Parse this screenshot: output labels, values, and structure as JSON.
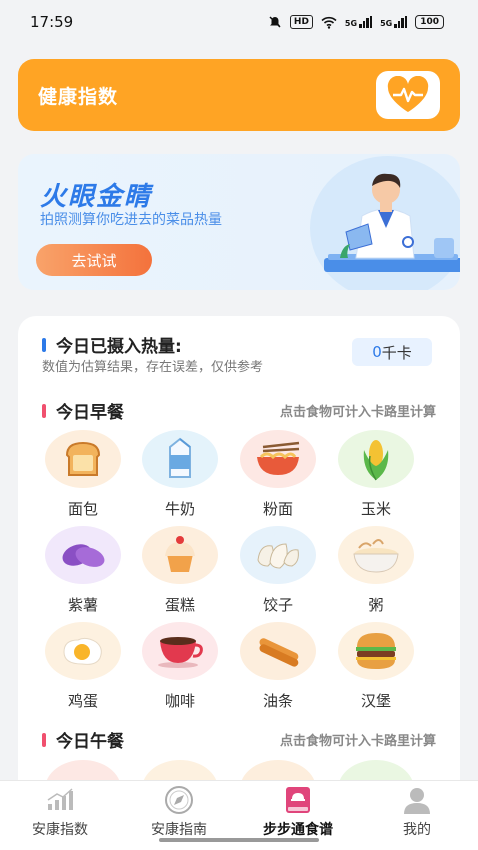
{
  "status_bar": {
    "time": "17:59",
    "hd": "HD",
    "sig1": "5G",
    "sig2": "5G",
    "battery": "100"
  },
  "health_index": {
    "title": "健康指数"
  },
  "banner": {
    "title": "火眼金睛",
    "subtitle": "拍照测算你吃进去的菜品热量",
    "button": "去试试"
  },
  "intake": {
    "title": "今日已摄入热量:",
    "subtitle": "数值为估算结果，存在误差，仅供参考",
    "value": "0",
    "unit": "千卡"
  },
  "breakfast": {
    "title": "今日早餐",
    "hint": "点击食物可计入卡路里计算",
    "items": [
      {
        "label": "面包",
        "icon": "bread-icon",
        "color": "#fdeedd"
      },
      {
        "label": "牛奶",
        "icon": "milk-icon",
        "color": "#e4f3fb"
      },
      {
        "label": "粉面",
        "icon": "noodles-icon",
        "color": "#fde8e4"
      },
      {
        "label": "玉米",
        "icon": "corn-icon",
        "color": "#eaf7e2"
      },
      {
        "label": "紫薯",
        "icon": "purple-sweet-potato-icon",
        "color": "#f1e8fb"
      },
      {
        "label": "蛋糕",
        "icon": "cake-icon",
        "color": "#fdeedd"
      },
      {
        "label": "饺子",
        "icon": "dumpling-icon",
        "color": "#e6f2fb"
      },
      {
        "label": "粥",
        "icon": "porridge-icon",
        "color": "#fdf1e0"
      },
      {
        "label": "鸡蛋",
        "icon": "egg-icon",
        "color": "#fdf1e0"
      },
      {
        "label": "咖啡",
        "icon": "coffee-icon",
        "color": "#fde8ea"
      },
      {
        "label": "油条",
        "icon": "fried-dough-icon",
        "color": "#fdeedd"
      },
      {
        "label": "汉堡",
        "icon": "hamburger-icon",
        "color": "#fdf1e0"
      }
    ]
  },
  "lunch": {
    "title": "今日午餐",
    "hint": "点击食物可计入卡路里计算"
  },
  "tabs": [
    {
      "label": "安康指数",
      "icon": "bar-chart-icon"
    },
    {
      "label": "安康指南",
      "icon": "compass-icon"
    },
    {
      "label": "步步通食谱",
      "icon": "recipe-book-icon"
    },
    {
      "label": "我的",
      "icon": "user-icon"
    }
  ],
  "colors": {
    "orange": "#ffa424",
    "blue": "#2d7ae8",
    "pink_bar": "#f0506e",
    "active_tab": "#e0457b"
  }
}
